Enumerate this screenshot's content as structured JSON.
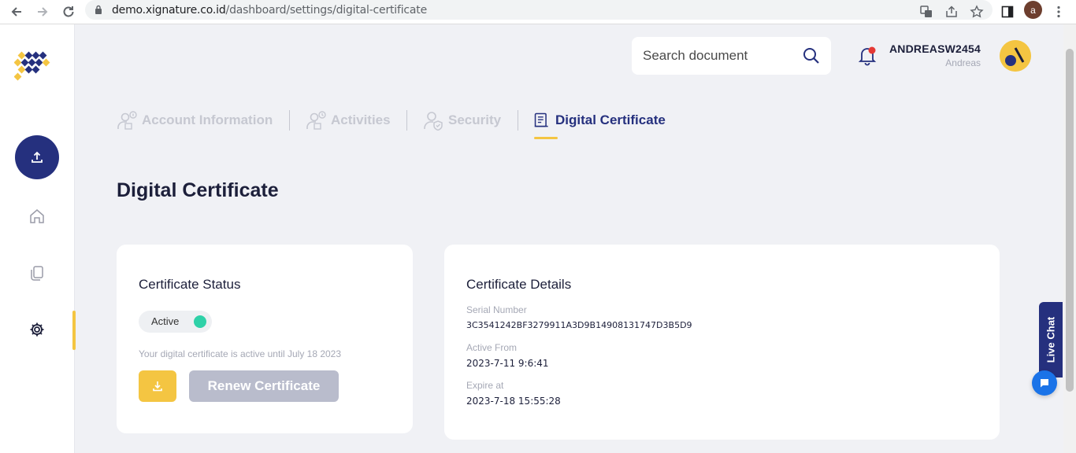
{
  "browser": {
    "url_host": "demo.xignature.co.id",
    "url_path": "/dashboard/settings/digital-certificate",
    "profile_initial": "a"
  },
  "header": {
    "search_placeholder": "Search document",
    "user_name": "ANDREASW2454",
    "user_sub": "Andreas",
    "notification_dot_color": "#e53935"
  },
  "tabs": [
    {
      "label": "Account Information",
      "icon": "user-info-icon"
    },
    {
      "label": "Activities",
      "icon": "user-clock-icon"
    },
    {
      "label": "Security",
      "icon": "user-shield-icon"
    },
    {
      "label": "Digital Certificate",
      "icon": "certificate-icon",
      "active": true
    }
  ],
  "page_title": "Digital Certificate",
  "status_card": {
    "title": "Certificate Status",
    "status": "Active",
    "note": "Your digital certificate is active until July 18 2023",
    "renew_label": "Renew Certificate"
  },
  "details_card": {
    "title": "Certificate Details",
    "serial_label": "Serial Number",
    "serial_value": "3C3541242BF3279911A3D9B14908131747D3B5D9",
    "active_from_label": "Active From",
    "active_from_value": "2023-7-11 9:6:41",
    "expire_label": "Expire at",
    "expire_value": "2023-7-18 15:55:28"
  },
  "live_chat_label": "Live Chat",
  "colors": {
    "primary": "#25307e",
    "accent": "#f4c542",
    "active_dot": "#2fd1a8"
  }
}
